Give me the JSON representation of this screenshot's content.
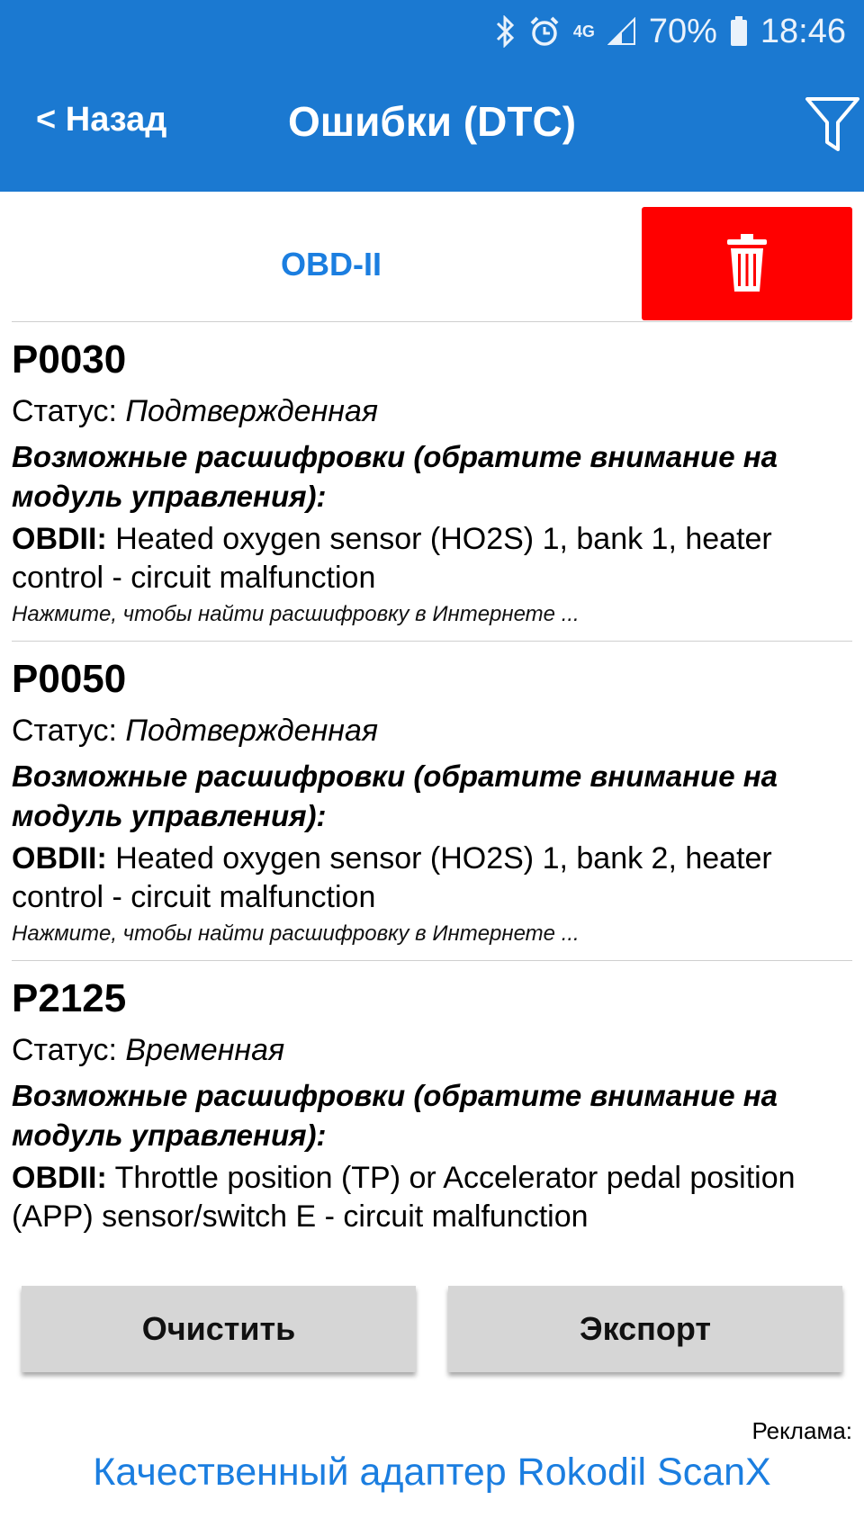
{
  "status_bar": {
    "battery": "70%",
    "time": "18:46",
    "network": "4G"
  },
  "header": {
    "back_label": "< Назад",
    "title": "Ошибки (DTC)",
    "filter_icon": "filter-icon"
  },
  "tabs": {
    "obd_label": "OBD-II",
    "delete_icon": "trash-icon",
    "delete_color": "#ff0000"
  },
  "dtc_list": [
    {
      "code": "P0030",
      "status_label": "Статус: ",
      "status_value": "Подтвержденная",
      "possible_label": "Возможные расшифровки (обратите внимание на модуль управления):",
      "decode_prefix": "OBDII:",
      "decode_text": " Heated oxygen sensor (HO2S) 1, bank 1, heater control - circuit malfunction",
      "hint": "Нажмите, чтобы найти расшифровку в Интернете ..."
    },
    {
      "code": "P0050",
      "status_label": "Статус: ",
      "status_value": "Подтвержденная",
      "possible_label": "Возможные расшифровки (обратите внимание на модуль управления):",
      "decode_prefix": "OBDII:",
      "decode_text": " Heated oxygen sensor (HO2S) 1, bank 2, heater control - circuit malfunction",
      "hint": "Нажмите, чтобы найти расшифровку в Интернете ..."
    },
    {
      "code": "P2125",
      "status_label": "Статус: ",
      "status_value": "Временная",
      "possible_label": "Возможные расшифровки (обратите внимание на модуль управления):",
      "decode_prefix": "OBDII:",
      "decode_text": " Throttle position (TP) or Accelerator pedal position (APP) sensor/switch E - circuit malfunction"
    }
  ],
  "actions": {
    "clear_label": "Очистить",
    "export_label": "Экспорт"
  },
  "ad": {
    "label": "Реклама:",
    "link_text": "Качественный адаптер Rokodil ScanX"
  },
  "colors": {
    "app_bar": "#1b79d1",
    "accent_link": "#1b7ee0",
    "button_bg": "#d6d6d6"
  }
}
